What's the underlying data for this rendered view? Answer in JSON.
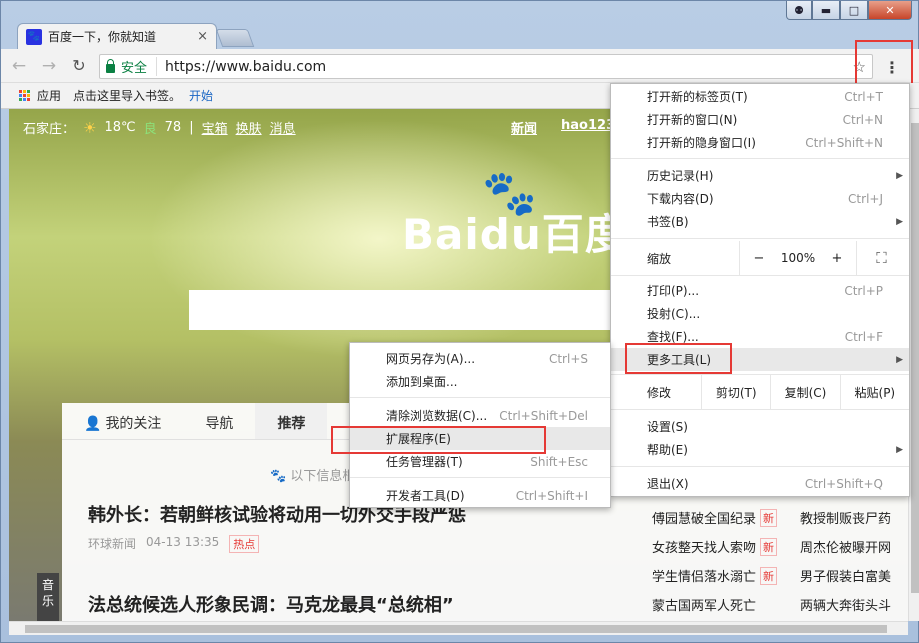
{
  "window": {
    "controls": [
      "⚉",
      "▬",
      "□",
      "✕"
    ]
  },
  "tab": {
    "favicon": "🐾",
    "title": "百度一下，你就知道",
    "close": "×"
  },
  "toolbar": {
    "back": "←",
    "forward": "→",
    "reload": "↻",
    "secure_label": "安全",
    "url": "https://www.baidu.com",
    "star": "☆",
    "menu": "⋮"
  },
  "bookmarks": {
    "apps_label": "应用",
    "hint": "点击这里导入书签。",
    "start_link": "开始"
  },
  "page": {
    "city": "石家庄：",
    "weather_icon": "sun-icon",
    "temperature": "18℃",
    "aqi_label": "良",
    "aqi_value": "78",
    "divider": "|",
    "links_left": [
      "宝箱",
      "换肤",
      "消息"
    ],
    "links_right": [
      "新闻",
      "hao123"
    ],
    "logo_text": "Baidu百度",
    "logo_paw": "🐾",
    "panel_tabs": [
      "我的关注",
      "导航",
      "推荐"
    ],
    "hint": "🐾 以下信息根",
    "headline1": "韩外长：若朝鲜核试验将动用一切外交手段严惩",
    "headline1_source": "环球新闻",
    "headline1_time": "04-13 13:35",
    "headline1_tag": "热点",
    "headline2": "法总统候选人形象民调：马克龙最具“总统相”",
    "music": "音乐",
    "news": [
      [
        "傅园慧破全国纪录",
        "新",
        "教授制贩丧尸药"
      ],
      [
        "女孩整天找人索吻",
        "新",
        "周杰伦被曝开网"
      ],
      [
        "学生情侣落水溺亡",
        "新",
        "男子假装白富美"
      ],
      [
        "蒙古国两军人死亡",
        "",
        "两辆大奔街头斗"
      ]
    ]
  },
  "main_menu": {
    "items": [
      {
        "label": "打开新的标签页(T)",
        "shortcut": "Ctrl+T"
      },
      {
        "label": "打开新的窗口(N)",
        "shortcut": "Ctrl+N"
      },
      {
        "label": "打开新的隐身窗口(I)",
        "shortcut": "Ctrl+Shift+N"
      },
      {
        "label": "历史记录(H)",
        "shortcut": ""
      },
      {
        "label": "下载内容(D)",
        "shortcut": "Ctrl+J"
      },
      {
        "label": "书签(B)",
        "shortcut": ""
      },
      {
        "label": "打印(P)...",
        "shortcut": "Ctrl+P"
      },
      {
        "label": "投射(C)...",
        "shortcut": ""
      },
      {
        "label": "查找(F)...",
        "shortcut": "Ctrl+F"
      },
      {
        "label": "更多工具(L)",
        "shortcut": ""
      },
      {
        "label": "设置(S)",
        "shortcut": ""
      },
      {
        "label": "帮助(E)",
        "shortcut": ""
      },
      {
        "label": "退出(X)",
        "shortcut": "Ctrl+Shift+Q"
      }
    ],
    "zoom": {
      "label": "缩放",
      "minus": "−",
      "value": "100%",
      "plus": "+",
      "fullscreen": "⛶"
    },
    "edit": {
      "label": "修改",
      "cut": "剪切(T)",
      "copy": "复制(C)",
      "paste": "粘贴(P)"
    },
    "arrow": "▶"
  },
  "sub_menu": {
    "items": [
      {
        "label": "网页另存为(A)...",
        "shortcut": "Ctrl+S"
      },
      {
        "label": "添加到桌面...",
        "shortcut": ""
      },
      {
        "label": "清除浏览数据(C)...",
        "shortcut": "Ctrl+Shift+Del"
      },
      {
        "label": "扩展程序(E)",
        "shortcut": ""
      },
      {
        "label": "任务管理器(T)",
        "shortcut": "Shift+Esc"
      },
      {
        "label": "开发者工具(D)",
        "shortcut": "Ctrl+Shift+I"
      }
    ]
  },
  "colors": {
    "accent_red": "#e53935",
    "secure_green": "#0b8043",
    "link_blue": "#1a66c4"
  }
}
